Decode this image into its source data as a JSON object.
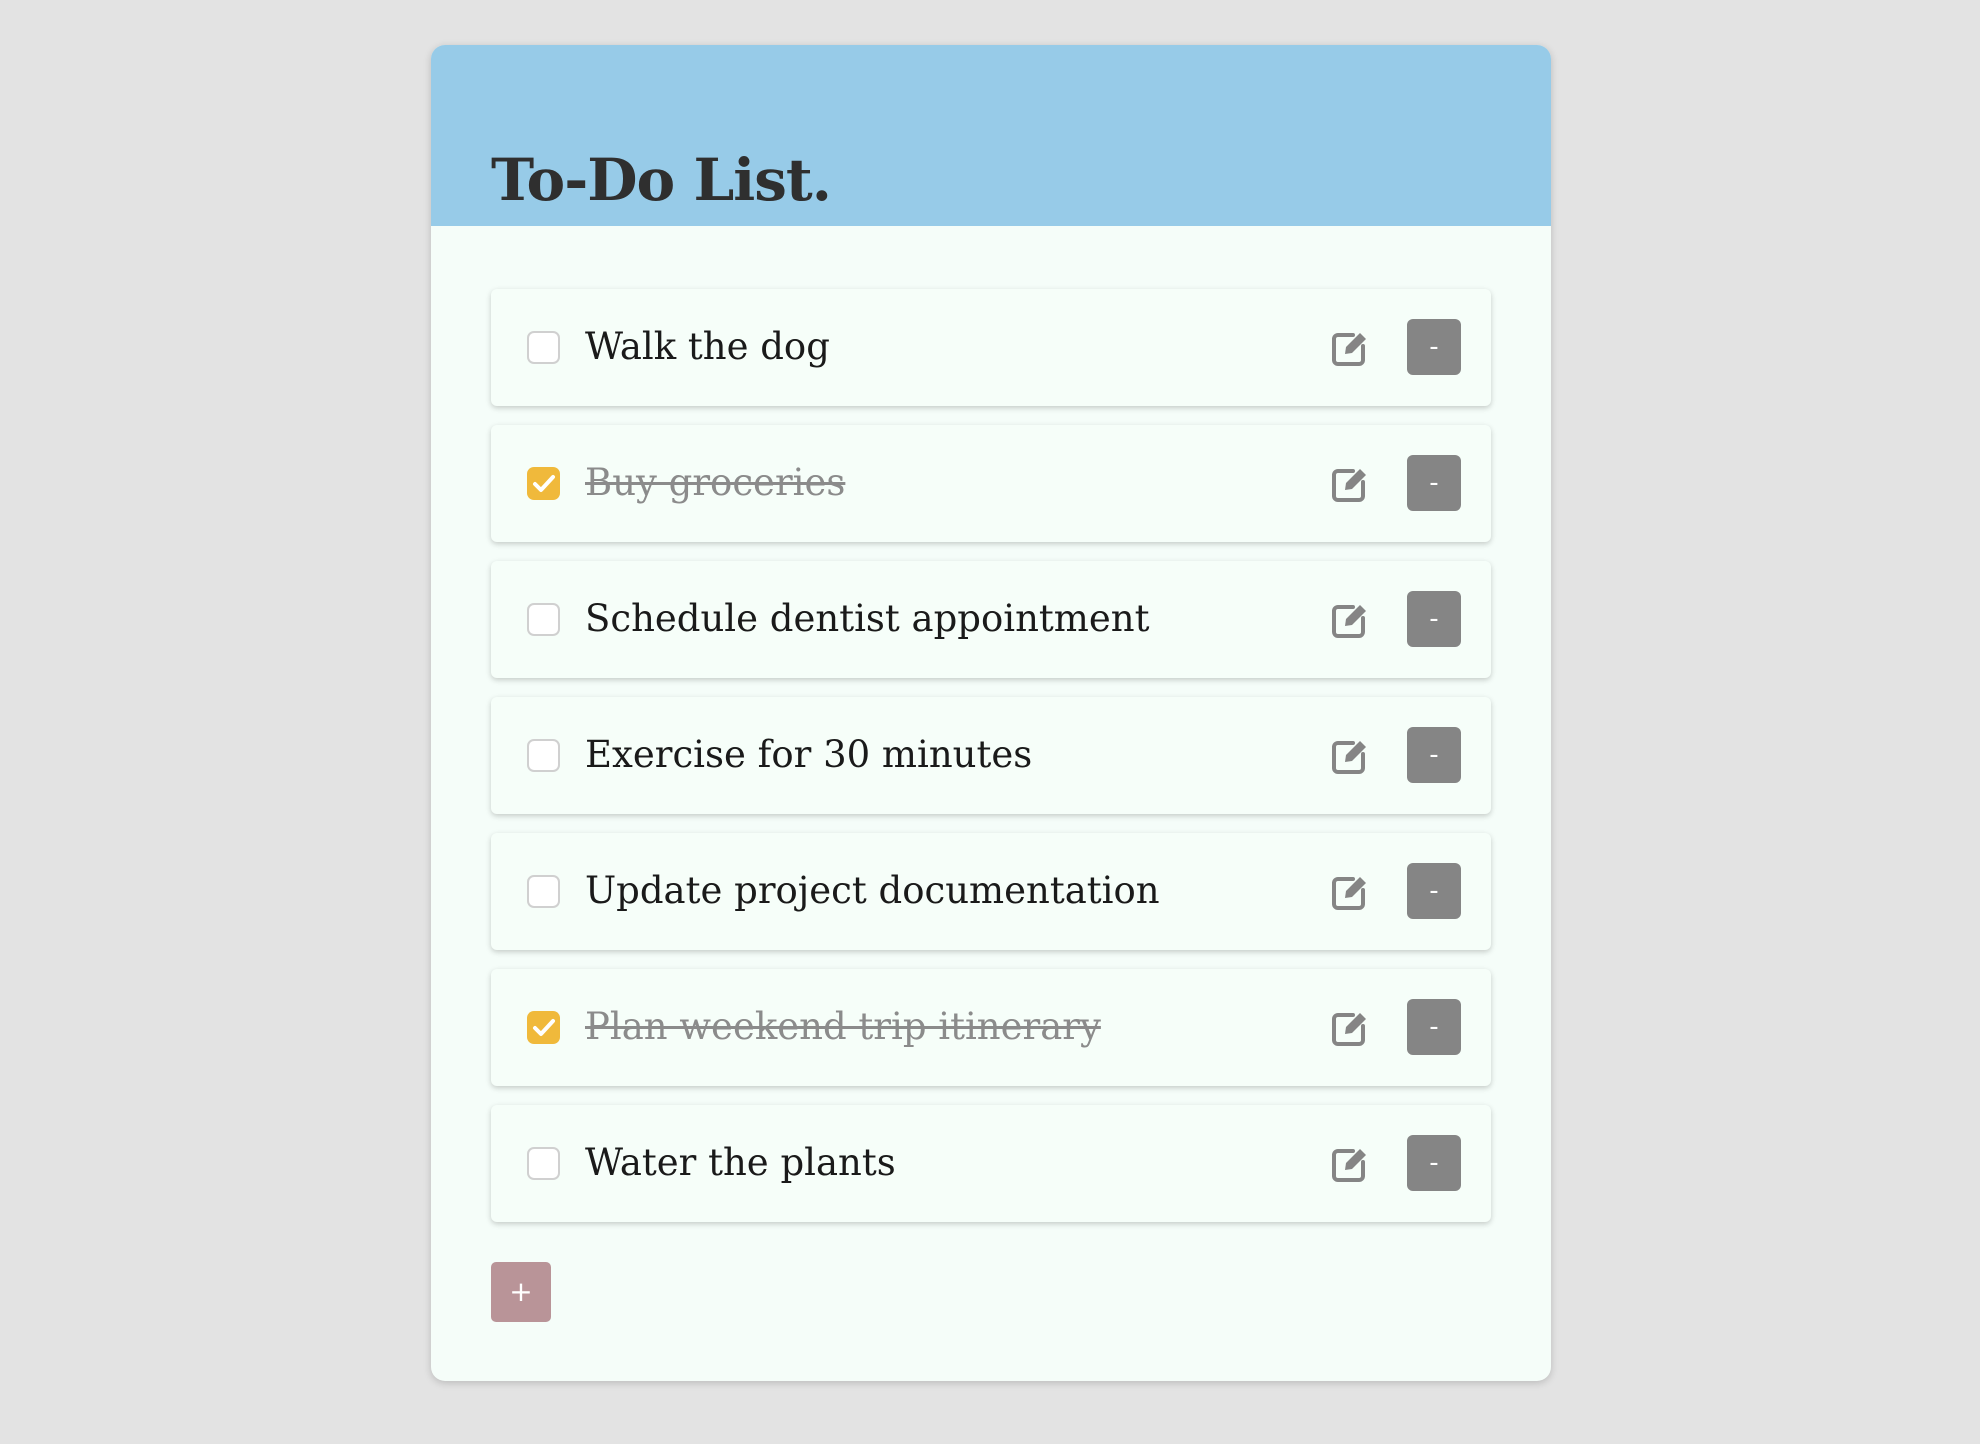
{
  "app": {
    "title": "To-Do List."
  },
  "todos": [
    {
      "text": "Walk the dog",
      "done": false
    },
    {
      "text": "Buy groceries",
      "done": true
    },
    {
      "text": "Schedule dentist appointment",
      "done": false
    },
    {
      "text": "Exercise for 30 minutes",
      "done": false
    },
    {
      "text": "Update project documentation",
      "done": false
    },
    {
      "text": "Plan weekend trip itinerary",
      "done": true
    },
    {
      "text": "Water the plants",
      "done": false
    }
  ],
  "actions": {
    "remove_label": "-",
    "add_label": "+",
    "edit_icon": "edit-icon"
  },
  "colors": {
    "header": "#97cbe8",
    "checked": "#f0b93b",
    "remove_button": "#858585",
    "add_button": "#b99498"
  }
}
